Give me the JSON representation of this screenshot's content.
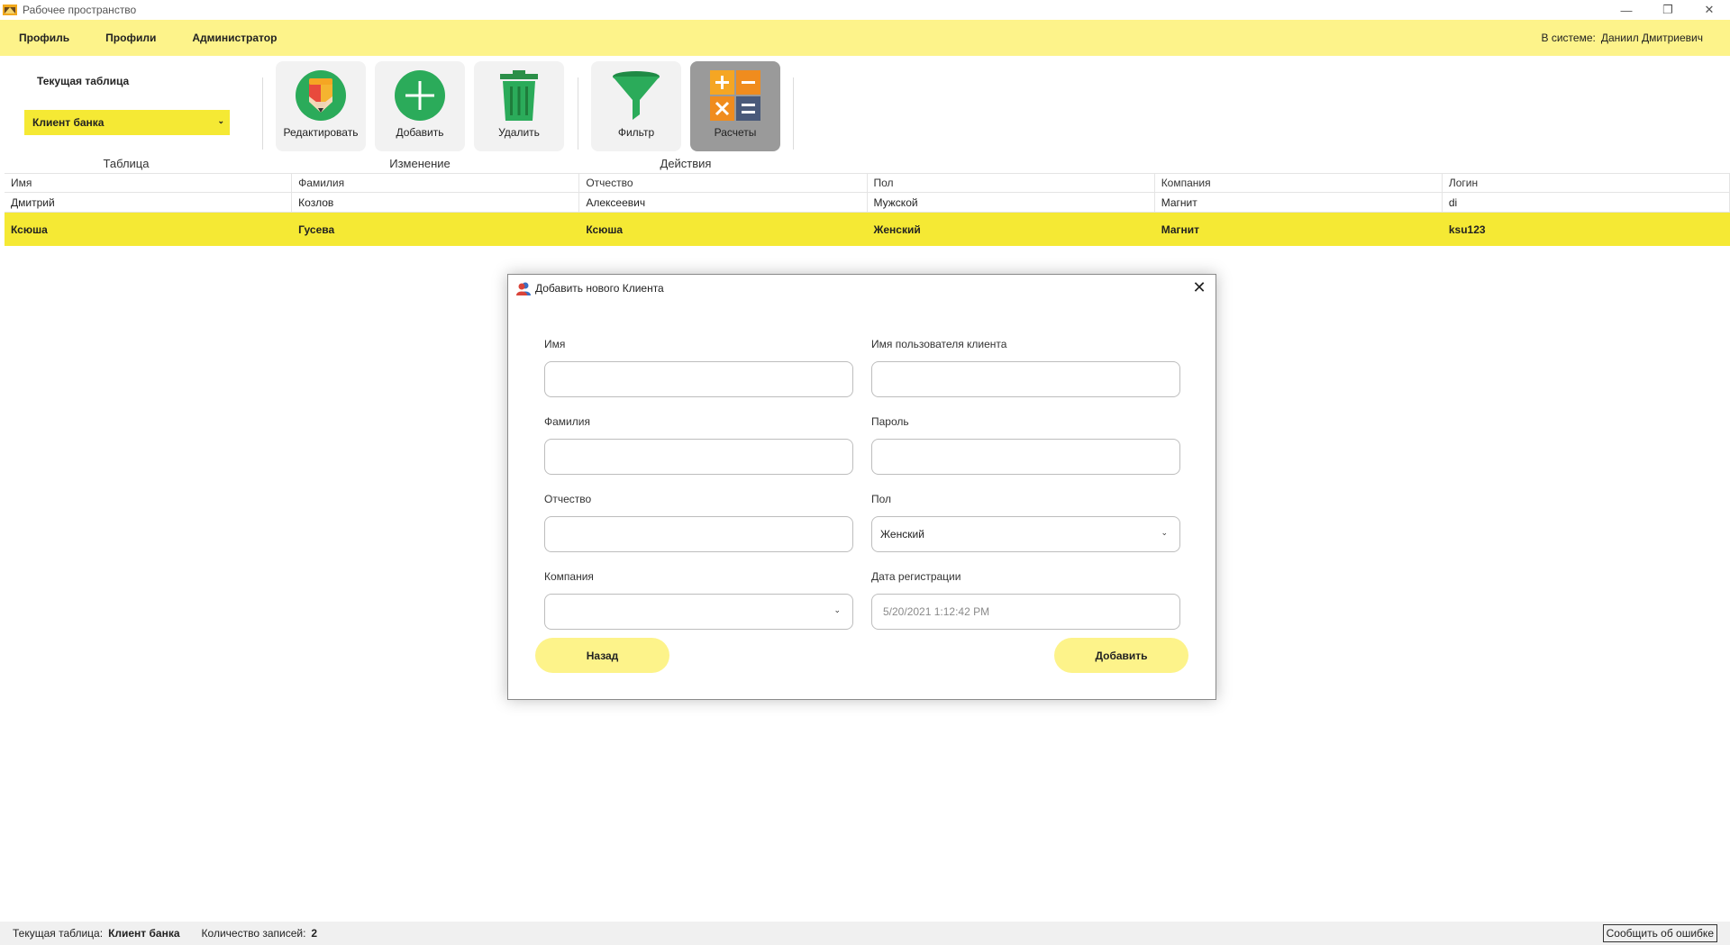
{
  "window": {
    "title": "Рабочее пространство",
    "controls": {
      "minimize": "—",
      "restore": "❐",
      "close": "✕"
    }
  },
  "menu": {
    "items": [
      {
        "label": "Профиль"
      },
      {
        "label": "Профили"
      },
      {
        "label": "Администратор"
      }
    ],
    "user_label": "В системе:",
    "user_name": "Даниил Дмитриевич"
  },
  "ribbon": {
    "current_table_label": "Текущая таблица",
    "current_table_value": "Клиент банка",
    "groups": {
      "table": "Таблица",
      "change": "Изменение",
      "actions": "Действия"
    },
    "buttons": {
      "edit": {
        "label": "Редактировать",
        "icon": "pencil-icon"
      },
      "add": {
        "label": "Добавить",
        "icon": "plus-circle-icon"
      },
      "delete": {
        "label": "Удалить",
        "icon": "trash-icon"
      },
      "filter": {
        "label": "Фильтр",
        "icon": "funnel-icon"
      },
      "calc": {
        "label": "Расчеты",
        "icon": "calculator-icon"
      }
    }
  },
  "grid": {
    "columns": [
      "Имя",
      "Фамилия",
      "Отчество",
      "Пол",
      "Компания",
      "Логин"
    ],
    "rows": [
      [
        "Дмитрий",
        "Козлов",
        "Алексеевич",
        "Мужской",
        "Магнит",
        "di"
      ],
      [
        "Ксюша",
        "Гусева",
        "Ксюша",
        "Женский",
        "Магнит",
        "ksu123"
      ]
    ]
  },
  "dialog": {
    "title": "Добавить нового Клиента",
    "close": "✕",
    "fields": {
      "first_name": {
        "label": "Имя",
        "value": ""
      },
      "last_name": {
        "label": "Фамилия",
        "value": ""
      },
      "patronymic": {
        "label": "Отчество",
        "value": ""
      },
      "company": {
        "label": "Компания",
        "value": ""
      },
      "username": {
        "label": "Имя пользователя клиента",
        "value": ""
      },
      "password": {
        "label": "Пароль",
        "value": ""
      },
      "gender": {
        "label": "Пол",
        "value": "Женский"
      },
      "reg_date": {
        "label": "Дата регистрации",
        "value": "5/20/2021 1:12:42 PM"
      }
    },
    "back_label": "Назад",
    "add_label": "Добавить"
  },
  "status": {
    "table_label": "Текущая таблица:",
    "table_value": "Клиент банка",
    "count_label": "Количество записей:",
    "count_value": "2",
    "report_label": "Сообщить об ошибке"
  },
  "colors": {
    "accent_yellow": "#fdf38a",
    "selection_yellow": "#f5e934",
    "active_button": "#9a9a9a"
  }
}
